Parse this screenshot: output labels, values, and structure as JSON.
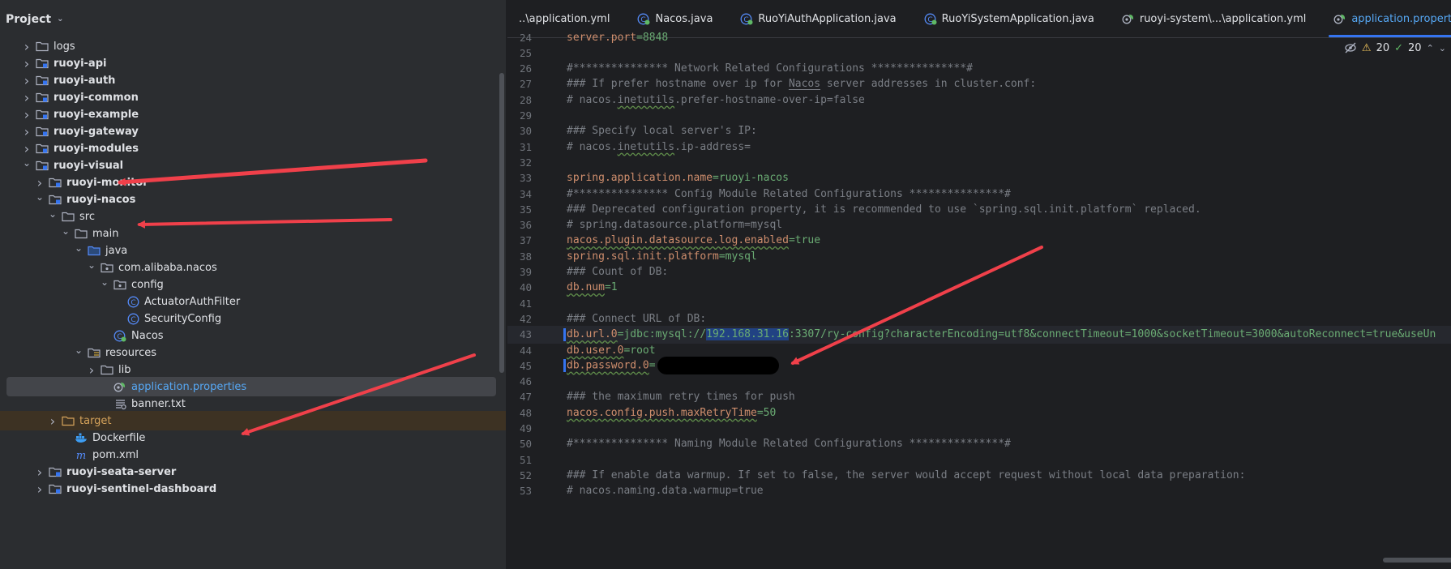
{
  "project_panel": {
    "title": "Project",
    "tree": [
      {
        "label": "logs",
        "depth": 0,
        "arrow": "right",
        "icon": "folder",
        "bold": false
      },
      {
        "label": "ruoyi-api",
        "depth": 0,
        "arrow": "right",
        "icon": "module",
        "bold": true
      },
      {
        "label": "ruoyi-auth",
        "depth": 0,
        "arrow": "right",
        "icon": "module",
        "bold": true
      },
      {
        "label": "ruoyi-common",
        "depth": 0,
        "arrow": "right",
        "icon": "module",
        "bold": true
      },
      {
        "label": "ruoyi-example",
        "depth": 0,
        "arrow": "right",
        "icon": "module",
        "bold": true
      },
      {
        "label": "ruoyi-gateway",
        "depth": 0,
        "arrow": "right",
        "icon": "module",
        "bold": true
      },
      {
        "label": "ruoyi-modules",
        "depth": 0,
        "arrow": "right",
        "icon": "module",
        "bold": true
      },
      {
        "label": "ruoyi-visual",
        "depth": 0,
        "arrow": "down",
        "icon": "module",
        "bold": true
      },
      {
        "label": "ruoyi-monitor",
        "depth": 1,
        "arrow": "right",
        "icon": "module",
        "bold": true
      },
      {
        "label": "ruoyi-nacos",
        "depth": 1,
        "arrow": "down",
        "icon": "module",
        "bold": true
      },
      {
        "label": "src",
        "depth": 2,
        "arrow": "down",
        "icon": "folder",
        "bold": false
      },
      {
        "label": "main",
        "depth": 3,
        "arrow": "down",
        "icon": "folder",
        "bold": false
      },
      {
        "label": "java",
        "depth": 4,
        "arrow": "down",
        "icon": "folder-source",
        "bold": false
      },
      {
        "label": "com.alibaba.nacos",
        "depth": 5,
        "arrow": "down",
        "icon": "package",
        "bold": false
      },
      {
        "label": "config",
        "depth": 6,
        "arrow": "down",
        "icon": "package",
        "bold": false
      },
      {
        "label": "ActuatorAuthFilter",
        "depth": 7,
        "arrow": "",
        "icon": "class",
        "bold": false
      },
      {
        "label": "SecurityConfig",
        "depth": 7,
        "arrow": "",
        "icon": "class",
        "bold": false
      },
      {
        "label": "Nacos",
        "depth": 6,
        "arrow": "",
        "icon": "spring-class",
        "bold": false
      },
      {
        "label": "resources",
        "depth": 4,
        "arrow": "down",
        "icon": "folder-resources",
        "bold": false
      },
      {
        "label": "lib",
        "depth": 5,
        "arrow": "right",
        "icon": "folder",
        "bold": false
      },
      {
        "label": "application.properties",
        "depth": 6,
        "arrow": "",
        "icon": "spring-properties",
        "bold": false,
        "selected": true
      },
      {
        "label": "banner.txt",
        "depth": 6,
        "arrow": "",
        "icon": "text-file",
        "bold": false
      },
      {
        "label": "target",
        "depth": 2,
        "arrow": "right",
        "icon": "folder-excluded",
        "bold": false,
        "excluded": true
      },
      {
        "label": "Dockerfile",
        "depth": 3,
        "arrow": "",
        "icon": "docker",
        "bold": false
      },
      {
        "label": "pom.xml",
        "depth": 3,
        "arrow": "",
        "icon": "maven",
        "bold": false
      },
      {
        "label": "ruoyi-seata-server",
        "depth": 1,
        "arrow": "right",
        "icon": "module",
        "bold": true
      },
      {
        "label": "ruoyi-sentinel-dashboard",
        "depth": 1,
        "arrow": "right",
        "icon": "module",
        "bold": true
      }
    ]
  },
  "tabs": [
    {
      "label": "..\\application.yml",
      "icon": "",
      "active": false
    },
    {
      "label": "Nacos.java",
      "icon": "spring-class",
      "active": false
    },
    {
      "label": "RuoYiAuthApplication.java",
      "icon": "spring-class",
      "active": false
    },
    {
      "label": "RuoYiSystemApplication.java",
      "icon": "spring-class",
      "active": false
    },
    {
      "label": "ruoyi-system\\...\\application.yml",
      "icon": "spring-properties",
      "active": false
    },
    {
      "label": "application.properties",
      "icon": "spring-properties",
      "active": true
    }
  ],
  "inspection": {
    "warnings": "20",
    "ok": "20"
  },
  "editor": {
    "lines": [
      {
        "n": "24",
        "segs": [
          {
            "t": "server.port",
            "c": "k"
          },
          {
            "t": "=8848",
            "c": "v"
          }
        ]
      },
      {
        "n": "25",
        "segs": []
      },
      {
        "n": "26",
        "segs": [
          {
            "t": "#*************** Network Related Configurations ***************#",
            "c": "c"
          }
        ]
      },
      {
        "n": "27",
        "segs": [
          {
            "t": "### If prefer hostname over ip for ",
            "c": "c"
          },
          {
            "t": "Nacos",
            "c": "c ulw"
          },
          {
            "t": " server addresses in cluster.conf:",
            "c": "c"
          }
        ]
      },
      {
        "n": "28",
        "segs": [
          {
            "t": "# nacos.",
            "c": "c"
          },
          {
            "t": "inetutils",
            "c": "c ul"
          },
          {
            "t": ".prefer-hostname-over-ip=false",
            "c": "c"
          }
        ]
      },
      {
        "n": "29",
        "segs": []
      },
      {
        "n": "30",
        "segs": [
          {
            "t": "### Specify local server's IP:",
            "c": "c"
          }
        ]
      },
      {
        "n": "31",
        "segs": [
          {
            "t": "# nacos.",
            "c": "c"
          },
          {
            "t": "inetutils",
            "c": "c ul"
          },
          {
            "t": ".ip-address=",
            "c": "c"
          }
        ]
      },
      {
        "n": "32",
        "segs": []
      },
      {
        "n": "33",
        "segs": [
          {
            "t": "spring.application.name",
            "c": "k"
          },
          {
            "t": "=ruoyi-nacos",
            "c": "v"
          }
        ]
      },
      {
        "n": "34",
        "segs": [
          {
            "t": "#*************** Config Module Related Configurations ***************#",
            "c": "c"
          }
        ]
      },
      {
        "n": "35",
        "segs": [
          {
            "t": "### Deprecated configuration property, it is recommended to use `spring.sql.init.platform` replaced.",
            "c": "c"
          }
        ]
      },
      {
        "n": "36",
        "segs": [
          {
            "t": "# spring.datasource.platform=mysql",
            "c": "c"
          }
        ]
      },
      {
        "n": "37",
        "segs": [
          {
            "t": "nacos.plugin.datasource.log.enabled",
            "c": "k ul"
          },
          {
            "t": "=true",
            "c": "v"
          }
        ]
      },
      {
        "n": "38",
        "segs": [
          {
            "t": "spring.sql.init.platform",
            "c": "k"
          },
          {
            "t": "=mysql",
            "c": "v"
          }
        ]
      },
      {
        "n": "39",
        "segs": [
          {
            "t": "### Count of DB:",
            "c": "c"
          }
        ]
      },
      {
        "n": "40",
        "segs": [
          {
            "t": "db.num",
            "c": "k ul"
          },
          {
            "t": "=1",
            "c": "v"
          }
        ]
      },
      {
        "n": "41",
        "segs": []
      },
      {
        "n": "42",
        "segs": [
          {
            "t": "### Connect URL of DB:",
            "c": "c"
          }
        ]
      },
      {
        "n": "43",
        "current": true,
        "gutter": true,
        "segs": [
          {
            "t": "db.url.0",
            "c": "k ul"
          },
          {
            "t": "=jdbc:mysql://",
            "c": "v"
          },
          {
            "t": "192.168.31.16",
            "c": "sel"
          },
          {
            "t": ":3307/ry-config?characterEncoding=utf8&connectTimeout=1000&socketTimeout=3000&autoReconnect=true&useUn",
            "c": "v"
          }
        ]
      },
      {
        "n": "44",
        "segs": [
          {
            "t": "db.user.0",
            "c": "k ul"
          },
          {
            "t": "=root",
            "c": "v"
          }
        ]
      },
      {
        "n": "45",
        "gutter": true,
        "redacted": true,
        "segs": [
          {
            "t": "db.password.0",
            "c": "k ul"
          },
          {
            "t": "=",
            "c": "v"
          }
        ]
      },
      {
        "n": "46",
        "segs": []
      },
      {
        "n": "47",
        "segs": [
          {
            "t": "### the maximum retry times for push",
            "c": "c"
          }
        ]
      },
      {
        "n": "48",
        "segs": [
          {
            "t": "nacos.config.push.maxRetryTime",
            "c": "k ul"
          },
          {
            "t": "=50",
            "c": "v"
          }
        ]
      },
      {
        "n": "49",
        "segs": []
      },
      {
        "n": "50",
        "segs": [
          {
            "t": "#*************** Naming Module Related Configurations ***************#",
            "c": "c"
          }
        ]
      },
      {
        "n": "51",
        "segs": []
      },
      {
        "n": "52",
        "segs": [
          {
            "t": "### If enable data warmup. If set to false, the server would accept request without local data preparation:",
            "c": "c"
          }
        ]
      },
      {
        "n": "53",
        "segs": [
          {
            "t": "# nacos.naming.data.warmup=true",
            "c": "c"
          }
        ]
      }
    ]
  },
  "colors": {
    "annotation_arrow": "#f0404a",
    "accent": "#3574f0"
  }
}
